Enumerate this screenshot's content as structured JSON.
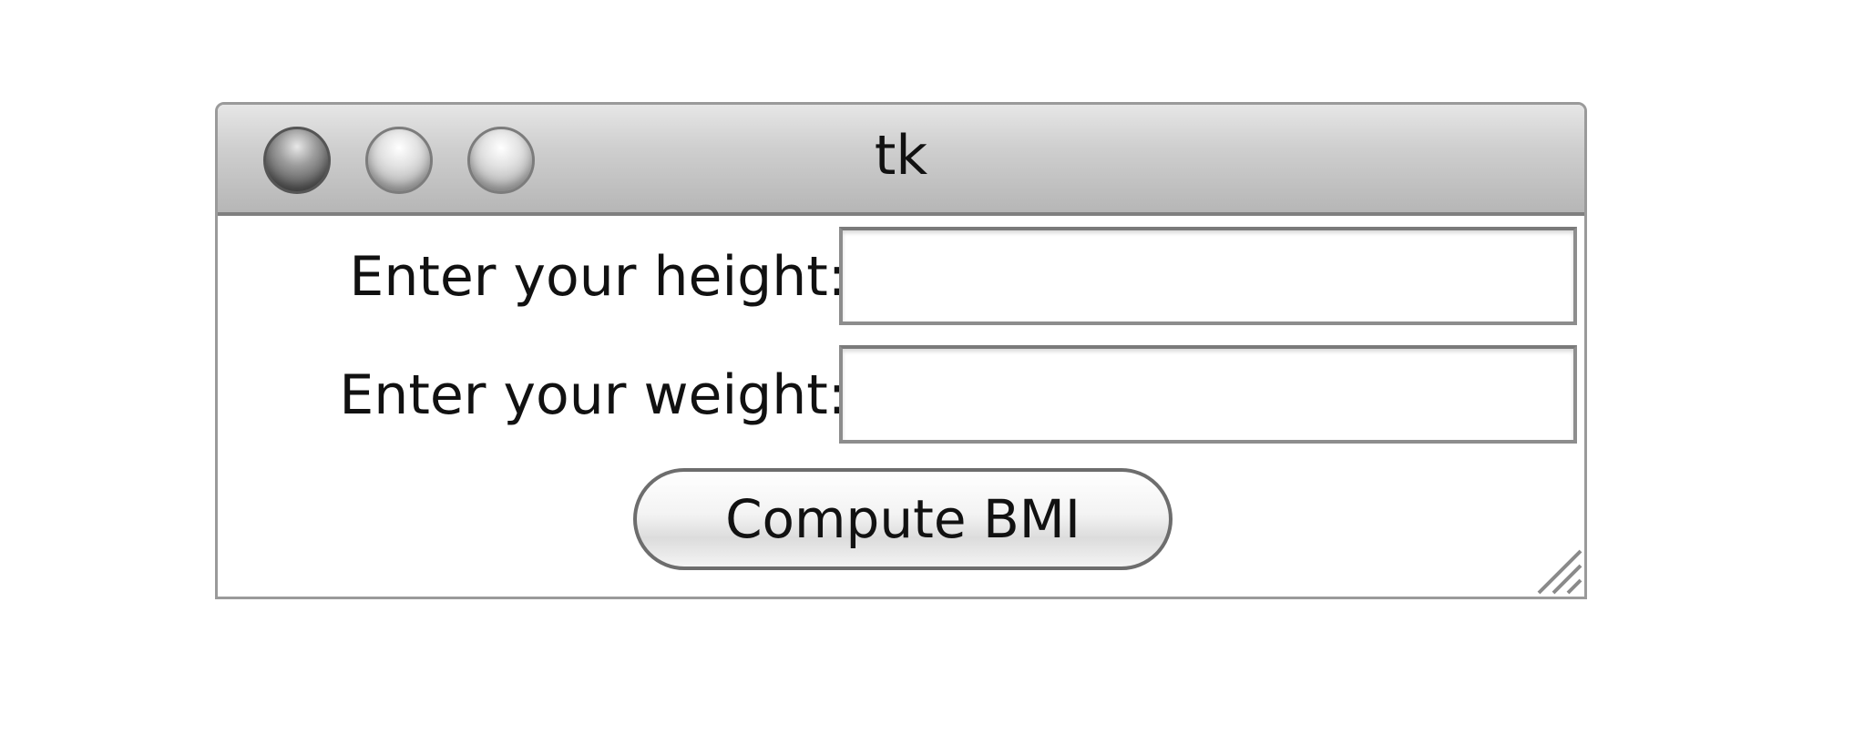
{
  "window": {
    "title": "tk"
  },
  "form": {
    "height_label": "Enter your height:",
    "height_value": "",
    "weight_label": "Enter your weight:",
    "weight_value": "",
    "compute_label": "Compute BMI"
  },
  "icons": {
    "close": "close-button-icon",
    "minimize": "minimize-button-icon",
    "zoom": "zoom-button-icon",
    "resize": "resize-grip-icon"
  }
}
